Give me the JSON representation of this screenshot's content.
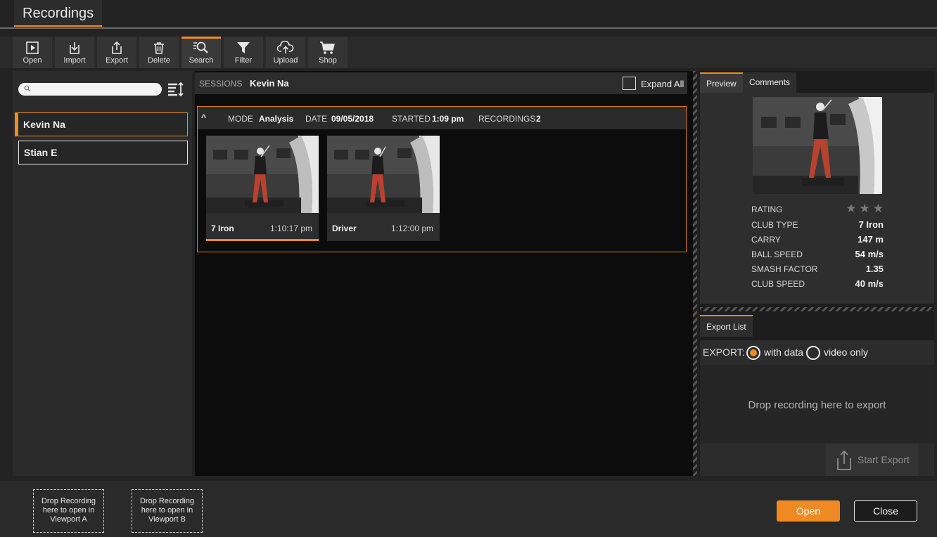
{
  "window": {
    "title": "Recordings"
  },
  "toolbar": {
    "items": [
      {
        "label": "Open",
        "icon": "play-icon"
      },
      {
        "label": "Import",
        "icon": "import-icon"
      },
      {
        "label": "Export",
        "icon": "export-icon"
      },
      {
        "label": "Delete",
        "icon": "trash-icon"
      },
      {
        "label": "Search",
        "icon": "search-icon",
        "active": true
      },
      {
        "label": "Filter",
        "icon": "filter-icon"
      },
      {
        "label": "Upload",
        "icon": "cloud-upload-icon"
      },
      {
        "label": "Shop",
        "icon": "cart-icon"
      }
    ]
  },
  "search": {
    "placeholder": ""
  },
  "players": [
    {
      "name": "Kevin Na",
      "selected": true
    },
    {
      "name": "Stian E",
      "selected": false
    }
  ],
  "sessions": {
    "label": "SESSIONS",
    "player": "Kevin Na",
    "expand_all_label": "Expand All",
    "expand_all_checked": false
  },
  "session": {
    "collapse_glyph": "^",
    "mode_label": "MODE",
    "mode": "Analysis",
    "date_label": "DATE",
    "date": "09/05/2018",
    "started_label": "STARTED",
    "started": "1:09 pm",
    "recordings_label": "RECORDINGS",
    "recordings": "2",
    "recordings_list": [
      {
        "club": "7 Iron",
        "time": "1:10:17 pm",
        "selected": true
      },
      {
        "club": "Driver",
        "time": "1:12:00 pm",
        "selected": false
      }
    ]
  },
  "preview": {
    "tabs": [
      "Preview",
      "Comments"
    ],
    "active_tab": "Preview",
    "rating_label": "RATING",
    "rating": 0,
    "rating_max": 3,
    "stats": [
      {
        "label": "CLUB TYPE",
        "value": "7 Iron"
      },
      {
        "label": "CARRY",
        "value": "147 m"
      },
      {
        "label": "BALL SPEED",
        "value": "54 m/s"
      },
      {
        "label": "SMASH FACTOR",
        "value": "1.35"
      },
      {
        "label": "CLUB SPEED",
        "value": "40 m/s"
      }
    ]
  },
  "export": {
    "tab": "Export List",
    "label": "EXPORT:",
    "options": [
      {
        "label": "with data",
        "selected": true
      },
      {
        "label": "video only",
        "selected": false
      }
    ],
    "drop_text": "Drop recording here to export",
    "start_label": "Start Export"
  },
  "viewports": [
    {
      "text": "Drop Recording here to open in Viewport A"
    },
    {
      "text": "Drop Recording here to open in Viewport B"
    }
  ],
  "footer": {
    "open_label": "Open",
    "close_label": "Close"
  },
  "colors": {
    "accent": "#f08a24",
    "background": "#232323"
  }
}
